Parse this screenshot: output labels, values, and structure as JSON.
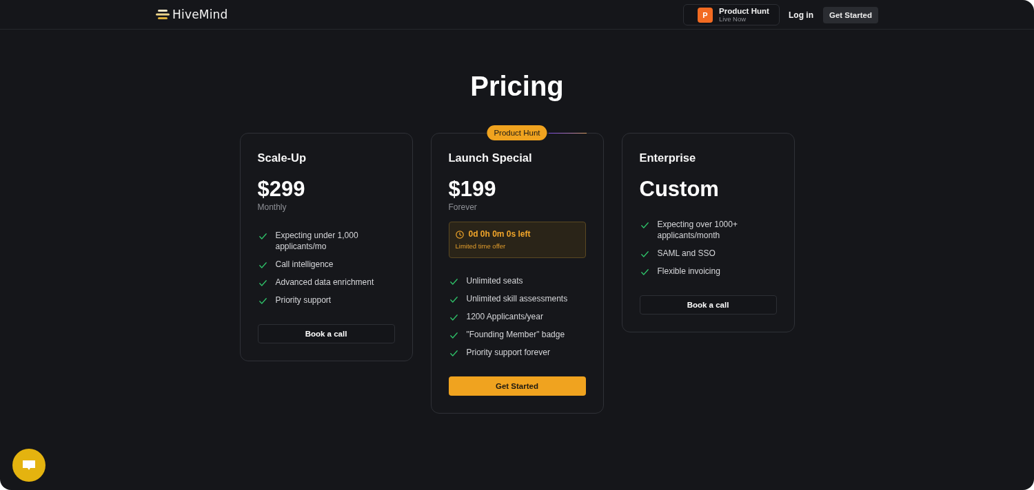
{
  "nav": {
    "logo": "HiveMind",
    "product_hunt": {
      "letter": "P",
      "title": "Product Hunt",
      "subtitle": "Live Now"
    },
    "login": "Log in",
    "cta": "Get Started"
  },
  "heading": "Pricing",
  "plans": [
    {
      "name": "Scale-Up",
      "price": "$299",
      "period": "Monthly",
      "features": [
        "Expecting under 1,000 applicants/mo",
        "Call intelligence",
        "Advanced data enrichment",
        "Priority support"
      ],
      "button": {
        "label": "Book a call",
        "kind": "outline"
      }
    },
    {
      "name": "Launch Special",
      "badge": "Product Hunt",
      "price": "$199",
      "period": "Forever",
      "countdown": {
        "time": "0d 0h 0m 0s left",
        "note": "Limited time offer"
      },
      "features": [
        "Unlimited seats",
        "Unlimited skill assessments",
        "1200 Applicants/year",
        "\"Founding Member\" badge",
        "Priority support forever"
      ],
      "button": {
        "label": "Get Started",
        "kind": "primary"
      }
    },
    {
      "name": "Enterprise",
      "price": "Custom",
      "features": [
        "Expecting over 1000+ applicants/month",
        "SAML and SSO",
        "Flexible invoicing"
      ],
      "button": {
        "label": "Book a call",
        "kind": "outline"
      }
    }
  ]
}
